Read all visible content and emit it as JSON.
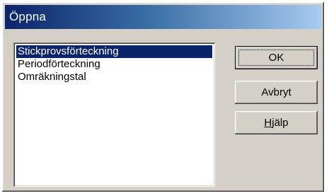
{
  "window": {
    "title": "Öppna",
    "colors": {
      "titlebar_start": "#0a246a",
      "titlebar_end": "#a6caf0",
      "face": "#d4d0c8",
      "selection": "#0a246a"
    }
  },
  "list": {
    "items": [
      {
        "label": "Stickprovsförteckning",
        "selected": true
      },
      {
        "label": "Periodförteckning",
        "selected": false
      },
      {
        "label": "Omräkningstal",
        "selected": false
      }
    ]
  },
  "buttons": {
    "ok_label": "OK",
    "cancel_label": "Avbryt",
    "help_accel": "H",
    "help_rest": "jälp"
  }
}
